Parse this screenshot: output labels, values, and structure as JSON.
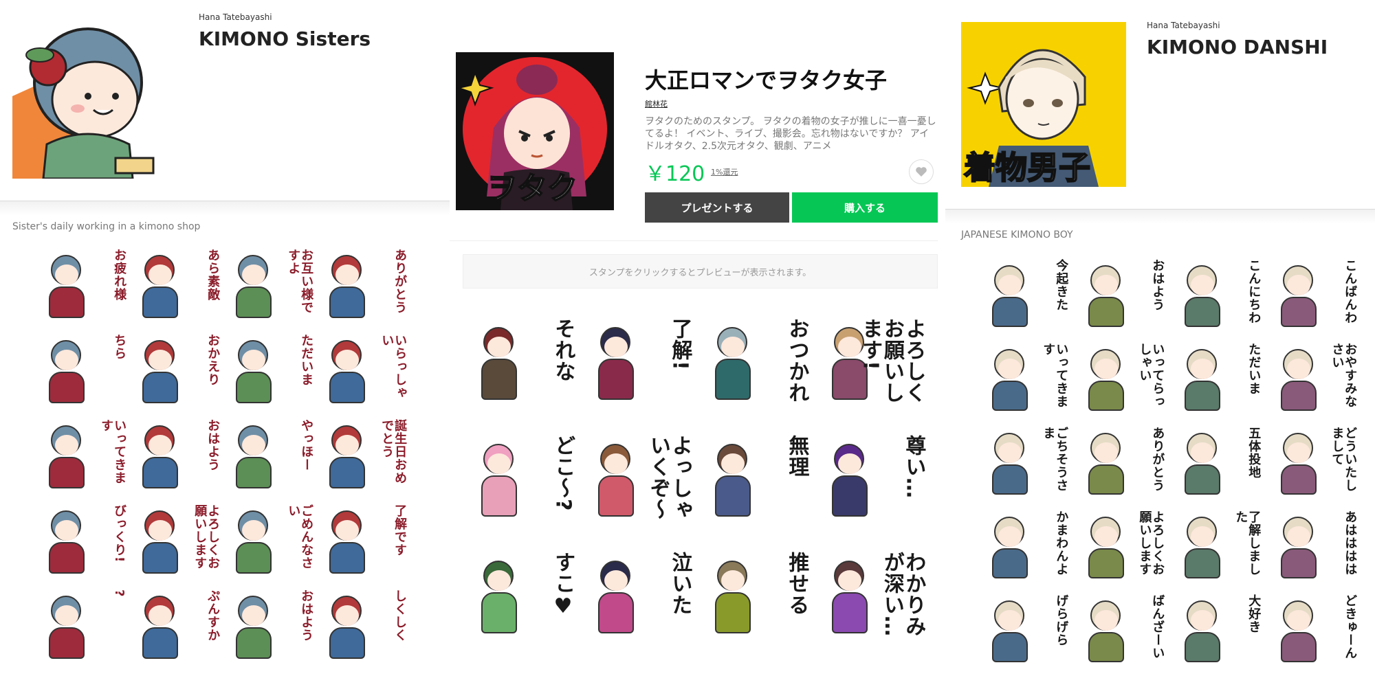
{
  "left_pack": {
    "author": "Hana Tatebayashi",
    "title": "KIMONO Sisters",
    "description": "Sister's daily working in a kimono shop",
    "stickers": [
      "お疲れ様",
      "あら素敵",
      "お互い様ですよ",
      "ありがとう",
      "ちら",
      "おかえり",
      "ただいま",
      "いらっしゃい",
      "いってきます",
      "おはよう",
      "やっほー",
      "誕生日おめでとう",
      "びっくり!",
      "よろしくお願いします",
      "ごめんなさい",
      "了解です",
      "?",
      "ぷんすか",
      "おはよう",
      "しくしく"
    ]
  },
  "mid_pack": {
    "title": "大正ロマンでヲタク女子",
    "author": "館林花",
    "description": "ヲタクのためのスタンプ。 ヲタクの着物の女子が推しに一喜一憂してるよ！ イベント、ライブ、撮影会。忘れ物はないですか？ アイドルオタク、2.5次元オタク、観劇、アニメ",
    "thumb_text": "ヲタク",
    "price": "￥120",
    "points": "1%還元",
    "present_button": "プレゼントする",
    "buy_button": "購入する",
    "preview_hint": "スタンプをクリックするとプレビューが表示されます。",
    "stickers": [
      "それな",
      "了解!",
      "おつかれ",
      "よろしくお願いします!",
      "どこ〜?",
      "よっしゃいくぞ〜",
      "無理",
      "尊い…",
      "すこ♥",
      "泣いた",
      "推せる",
      "わかりみが深い…"
    ]
  },
  "right_pack": {
    "author": "Hana Tatebayashi",
    "title": "KIMONO DANSHI",
    "description": "JAPANESE KIMONO BOY",
    "thumb_text": "着物男子",
    "stickers": [
      "今起きた",
      "おはよう",
      "こんにちわ",
      "こんばんわ",
      "いってきます",
      "いってらっしゃい",
      "ただいま",
      "おやすみなさい",
      "ごちそうさま",
      "ありがとう",
      "五体投地",
      "どういたしまして",
      "かまわんよ",
      "よろしくお願いします",
      "了解しました",
      "あはははは",
      "げらげら",
      "ばんざーい",
      "大好き",
      "どきゅーん"
    ]
  },
  "colors": {
    "line_green": "#06c755",
    "present_dark": "#444444",
    "price_green": "#06c755",
    "left_text": "#8b1c2a",
    "mid_text": "#1a1a1a",
    "right_text": "#1a1a1a"
  },
  "icons": {
    "favorite": "heart-icon"
  }
}
